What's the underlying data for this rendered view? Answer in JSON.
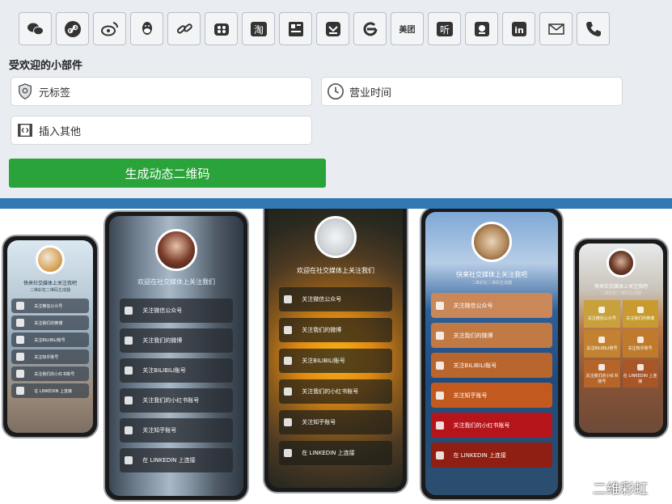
{
  "social_icons": [
    {
      "name": "wechat-icon",
      "glyph": ""
    },
    {
      "name": "link-circle-icon",
      "glyph": ""
    },
    {
      "name": "weibo-icon",
      "glyph": ""
    },
    {
      "name": "qq-icon",
      "glyph": ""
    },
    {
      "name": "chain-link-icon",
      "glyph": ""
    },
    {
      "name": "bilibili-icon",
      "glyph": ""
    },
    {
      "name": "taobao-icon",
      "glyph": "淘"
    },
    {
      "name": "toutiao-icon",
      "glyph": ""
    },
    {
      "name": "douban-icon",
      "glyph": ""
    },
    {
      "name": "e-icon",
      "glyph": ""
    },
    {
      "name": "meituan-icon",
      "glyph": "美团"
    },
    {
      "name": "ting-icon",
      "glyph": "听"
    },
    {
      "name": "dianping-icon",
      "glyph": ""
    },
    {
      "name": "linkedin-icon",
      "glyph": "in"
    },
    {
      "name": "email-icon",
      "glyph": ""
    },
    {
      "name": "phone-icon",
      "glyph": ""
    }
  ],
  "section": {
    "popular_widgets": "受欢迎的小部件"
  },
  "widgets": {
    "meta_tag": "元标签",
    "business_hours": "营业时间",
    "insert_other": "插入其他"
  },
  "generate_button": "生成动态二维码",
  "phones": {
    "p1": {
      "title": "快来社交媒体上关注我吧",
      "subtitle": "二维彩虹二维码生成器",
      "buttons": [
        "关注微信公众号",
        "关注我们的微博",
        "关注BILIBILI账号",
        "关注知乎账号",
        "关注我们的小红书账号",
        "在 LINKEDIN 上连接"
      ]
    },
    "p2": {
      "title": "欢迎在社交媒体上关注我们",
      "buttons": [
        "关注微信公众号",
        "关注我们的微博",
        "关注BILIBILI账号",
        "关注我们的小红书账号",
        "关注知乎账号",
        "在 LINKEDIN 上连接"
      ]
    },
    "p3": {
      "title": "欢迎在社交媒体上关注我们",
      "buttons": [
        "关注微信公众号",
        "关注我们的微博",
        "关注BILIBILI账号",
        "关注我们的小红书账号",
        "关注知乎账号",
        "在 LINKEDIN 上连接"
      ]
    },
    "p4": {
      "title": "快来社交媒体上关注我吧",
      "subtitle": "二维彩虹二维码生成器",
      "buttons": [
        "关注微信公众号",
        "关注我们的微博",
        "关注BILIBILI账号",
        "关注知乎账号",
        "关注我们的小红书账号",
        "在 LINKEDIN 上连接"
      ]
    },
    "p5": {
      "title": "快来社交媒体上关注我吧",
      "subtitle": "二维彩虹二维码生成器",
      "cells": [
        "关注微信公众号",
        "关注我们的微博",
        "关注BILIBILI账号",
        "关注知乎账号",
        "关注我们的小红书账号",
        "在 LINKEDIN 上连接"
      ]
    }
  },
  "watermark": "二维彩虹",
  "colors": {
    "generate_green": "#2aa33a",
    "strip_blue": "#2f78b2",
    "p4_buttons": [
      "#c9875a",
      "#c27a45",
      "#b8652e",
      "#c25a1f",
      "#b5141a",
      "#8e1f12"
    ],
    "p5_cells": [
      "#c9a13c",
      "#c79b2f",
      "#c3822f",
      "#bf7a2b",
      "#b5652a",
      "#a85528"
    ]
  }
}
